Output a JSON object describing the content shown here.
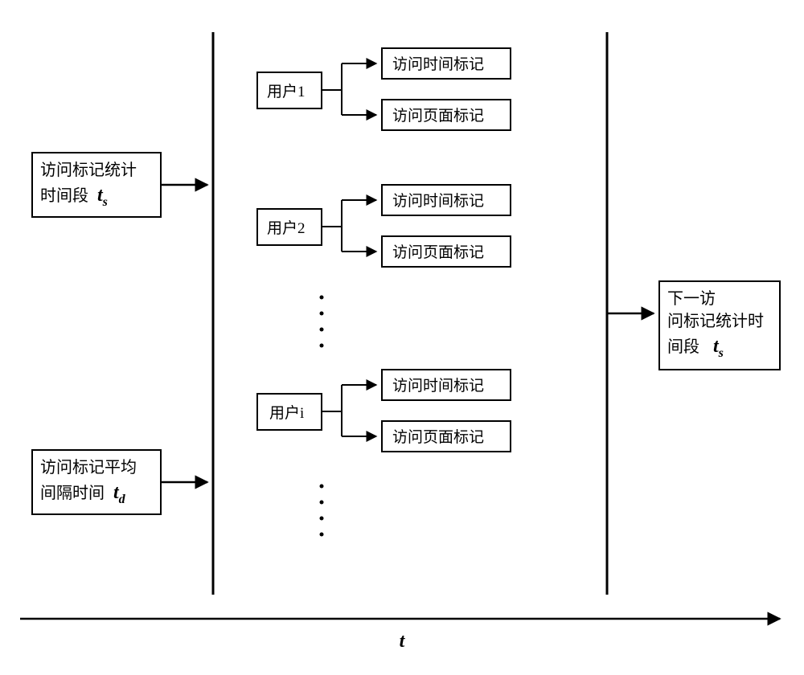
{
  "left": {
    "stats": {
      "line1": "访问标记统计",
      "line2_prefix": "时间段",
      "var": "t",
      "sub": "s"
    },
    "avg": {
      "line1": "访问标记平均",
      "line2_prefix": "间隔时间",
      "var": "t",
      "sub": "d"
    }
  },
  "users": {
    "u1": {
      "label": "用户1",
      "time": "访问时间标记",
      "page": "访问页面标记"
    },
    "u2": {
      "label": "用户2",
      "time": "访问时间标记",
      "page": "访问页面标记"
    },
    "ui": {
      "label": "用户i",
      "time": "访问时间标记",
      "page": "访问页面标记"
    }
  },
  "right": {
    "line1": "下一访",
    "line2": "问标记统计时",
    "line3_prefix": "间段",
    "var": "t",
    "sub": "s"
  },
  "axis": {
    "label": "t"
  }
}
